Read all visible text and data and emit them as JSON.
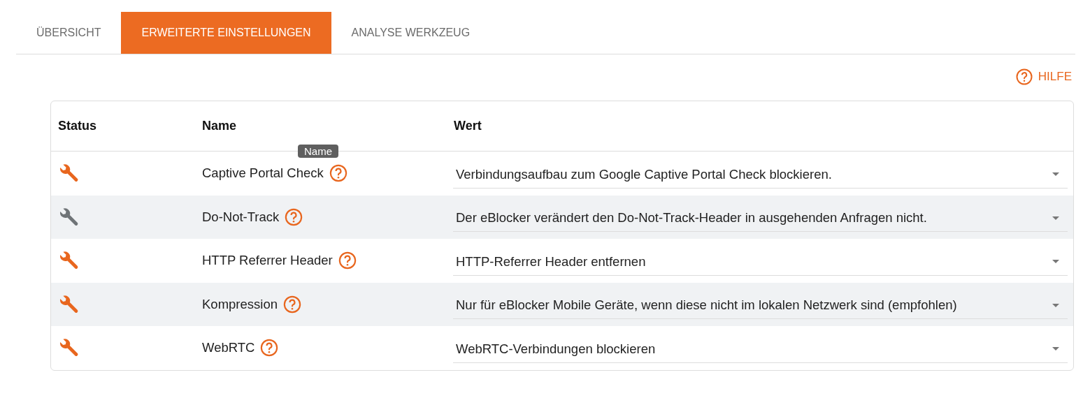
{
  "tabs": [
    {
      "label": "ÜBERSICHT",
      "selected": false
    },
    {
      "label": "ERWEITERTE EINSTELLUNGEN",
      "selected": true
    },
    {
      "label": "ANALYSE WERKZEUG",
      "selected": false
    }
  ],
  "help": {
    "label": "HILFE"
  },
  "table": {
    "columns": [
      "Status",
      "Name",
      "Wert"
    ],
    "rows": [
      {
        "active": true,
        "name": "Captive Portal Check",
        "tooltip": "Name",
        "value": "Verbindungsaufbau zum Google Captive Portal Check blockieren."
      },
      {
        "active": false,
        "name": "Do-Not-Track",
        "value": "Der eBlocker verändert den Do-Not-Track-Header in ausgehenden Anfragen nicht."
      },
      {
        "active": true,
        "name": "HTTP Referrer Header",
        "value": "HTTP-Referrer Header entfernen"
      },
      {
        "active": true,
        "name": "Kompression",
        "value": "Nur für eBlocker Mobile Geräte, wenn diese nicht im lokalen Netzwerk sind (empfohlen)"
      },
      {
        "active": true,
        "name": "WebRTC",
        "value": "WebRTC-Verbindungen blockieren"
      }
    ]
  }
}
